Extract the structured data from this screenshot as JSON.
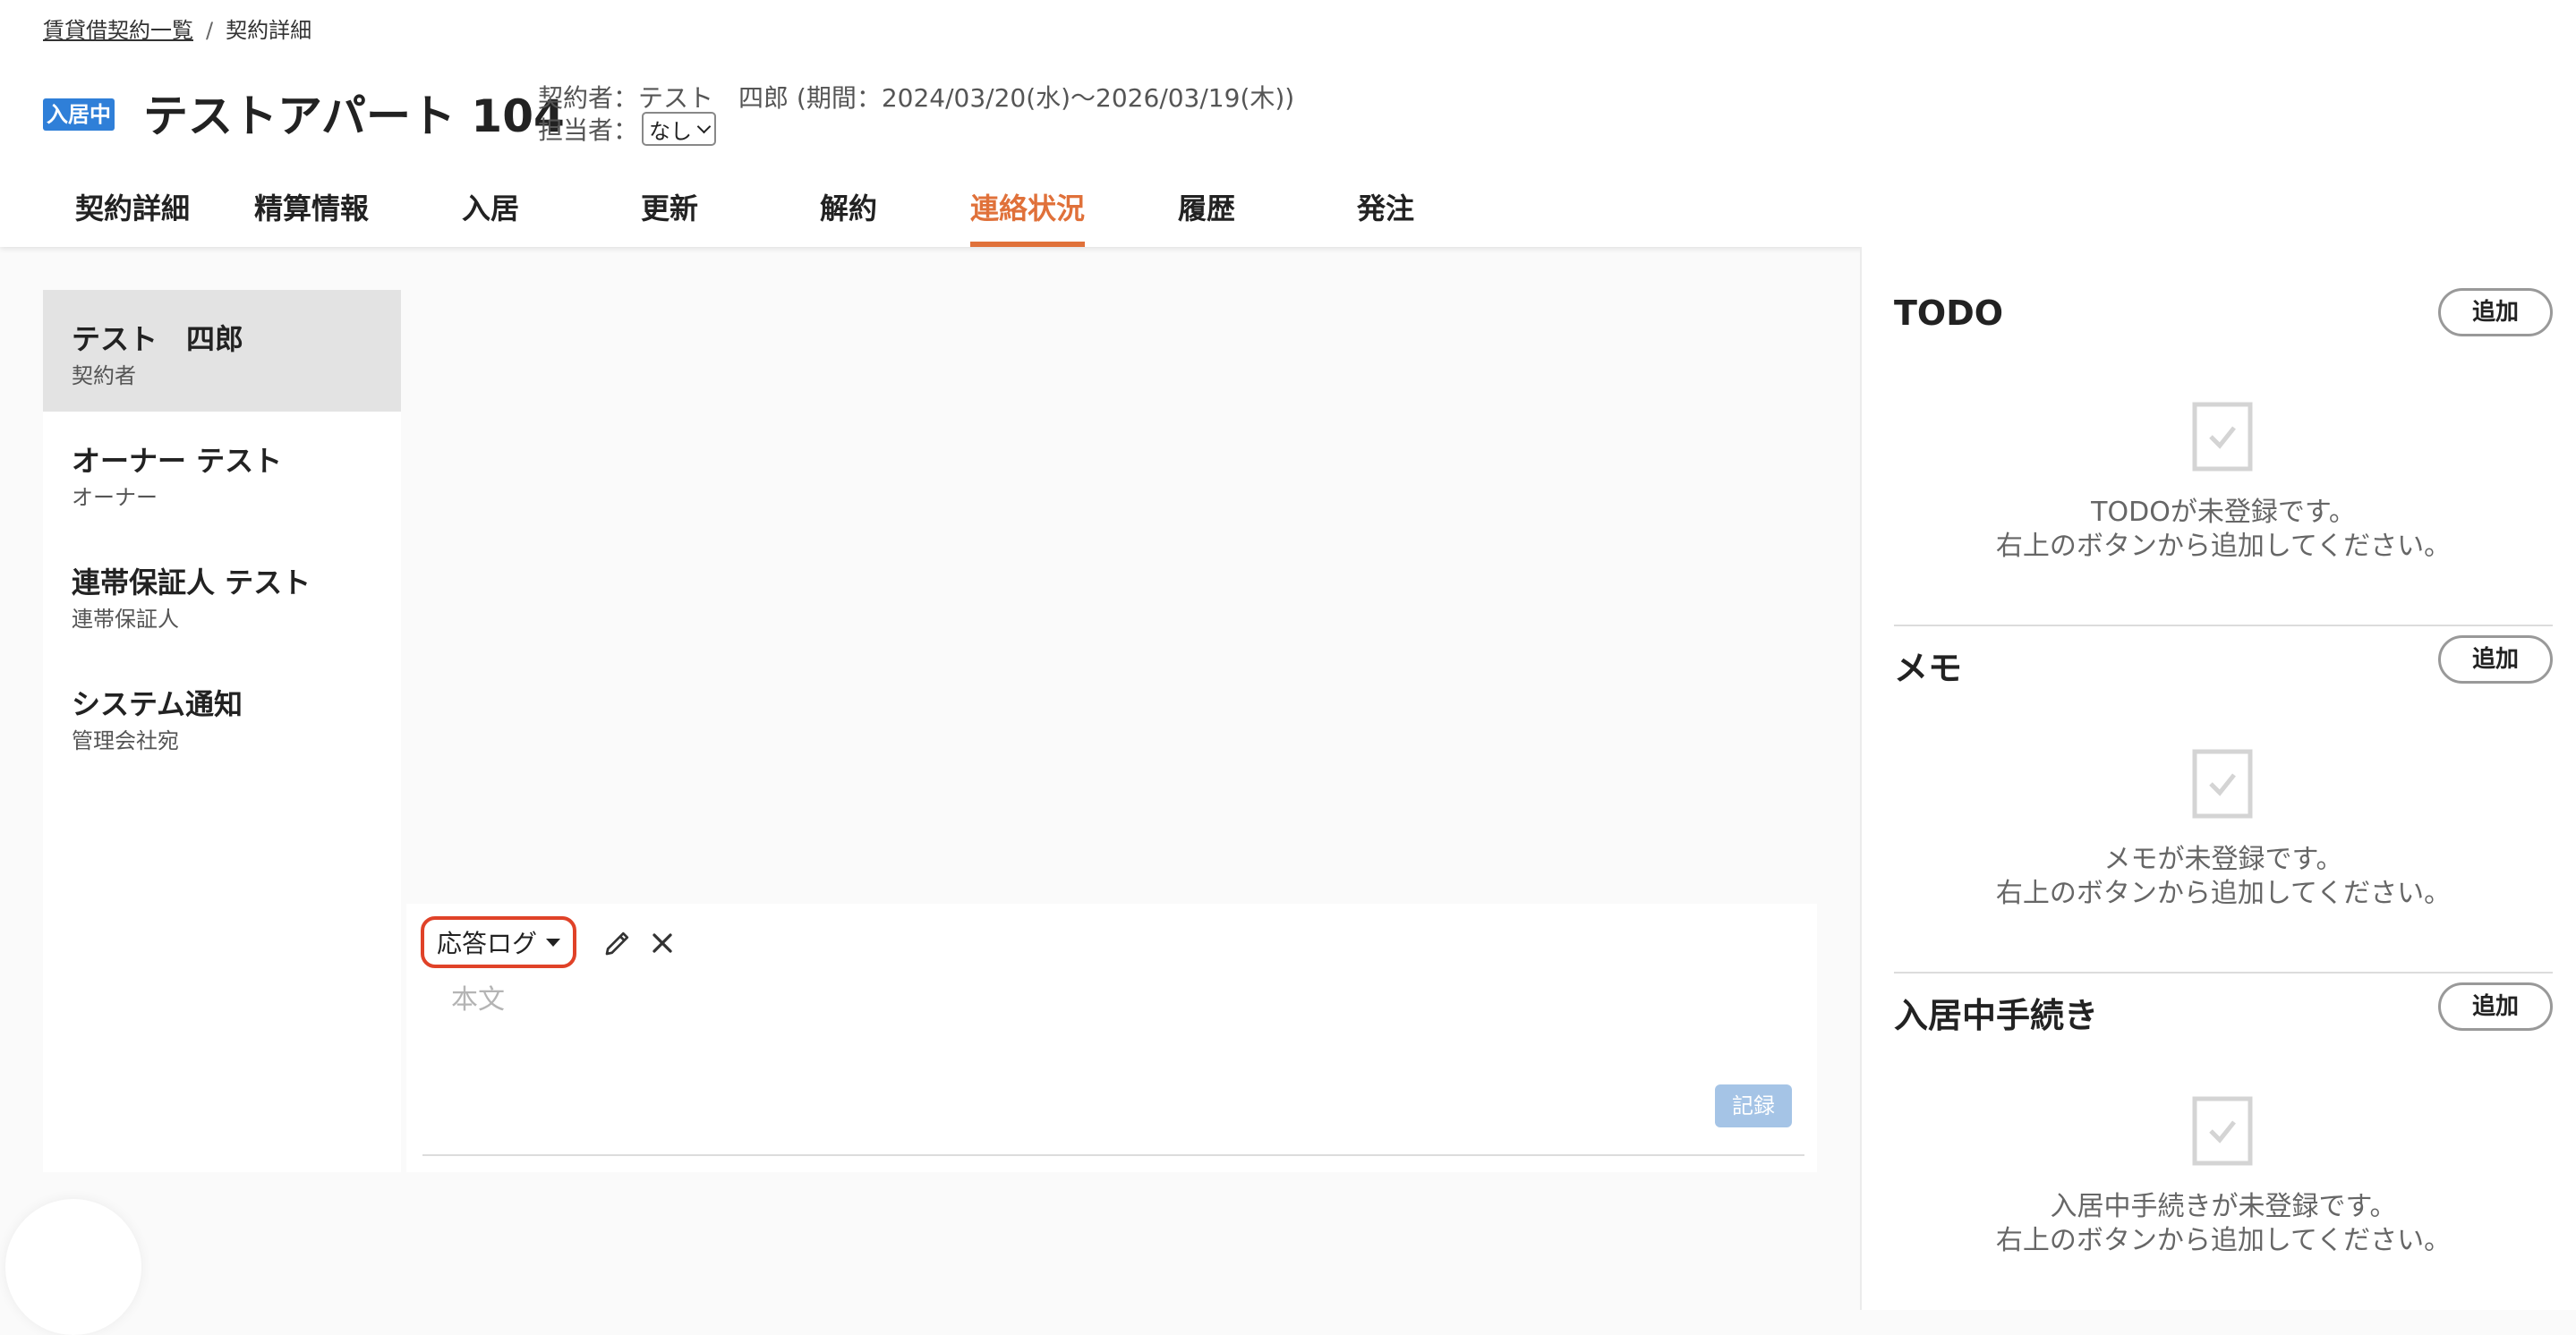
{
  "breadcrumb": {
    "parent": "賃貸借契約一覧",
    "separator": "/",
    "current": "契約詳細"
  },
  "header": {
    "status_badge": "入居中",
    "title": "テストアパート 104",
    "contract_info": "契約者：テスト　四郎 (期間：2024/03/20(水)〜2026/03/19(木))",
    "assignee_label": "担当者：",
    "assignee_value": "なし"
  },
  "tabs": [
    {
      "label": "契約詳細"
    },
    {
      "label": "精算情報"
    },
    {
      "label": "入居"
    },
    {
      "label": "更新"
    },
    {
      "label": "解約"
    },
    {
      "label": "連絡状況",
      "active": true
    },
    {
      "label": "履歴"
    },
    {
      "label": "発注"
    }
  ],
  "contacts": [
    {
      "name": "テスト　四郎",
      "role": "契約者",
      "selected": true
    },
    {
      "name": "オーナー テスト",
      "role": "オーナー"
    },
    {
      "name": "連帯保証人 テスト",
      "role": "連帯保証人"
    },
    {
      "name": "システム通知",
      "role": "管理会社宛"
    }
  ],
  "composer": {
    "type_label": "応答ログ",
    "body_placeholder": "本文",
    "record_label": "記録"
  },
  "right_panel": {
    "sections": [
      {
        "title": "TODO",
        "add_label": "追加",
        "empty_line1": "TODOが未登録です。",
        "empty_line2": "右上のボタンから追加してください。"
      },
      {
        "title": "メモ",
        "add_label": "追加",
        "empty_line1": "メモが未登録です。",
        "empty_line2": "右上のボタンから追加してください。"
      },
      {
        "title": "入居中手続き",
        "add_label": "追加",
        "empty_line1": "入居中手続きが未登録です。",
        "empty_line2": "右上のボタンから追加してください。"
      }
    ]
  },
  "colors": {
    "accent": "#e0713a",
    "badge": "#2f7fd8",
    "highlight_border": "#e04228",
    "record_button": "#a5c4e6"
  },
  "icons": {
    "edit": "pencil-icon",
    "close": "close-icon",
    "empty": "checkbox-checked-icon",
    "dropdown": "caret-down-icon"
  }
}
